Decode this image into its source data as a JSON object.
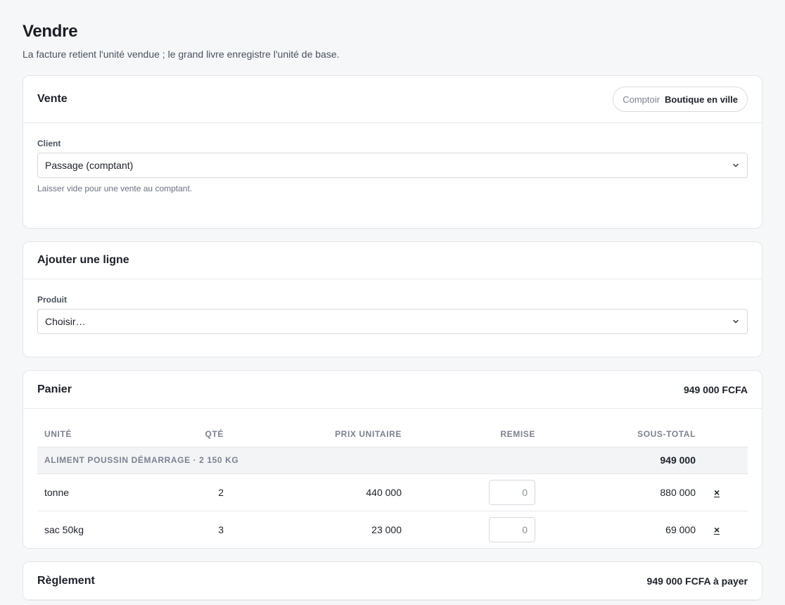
{
  "page": {
    "title": "Vendre",
    "subtitle": "La facture retient l'unité vendue ; le grand livre enregistre l'unité de base."
  },
  "sale": {
    "heading": "Vente",
    "counter_label": "Comptoir",
    "counter_value": "Boutique en ville",
    "client_label": "Client",
    "client_value": "Passage (comptant)",
    "client_hint": "Laisser vide pour une vente au comptant."
  },
  "add_line": {
    "heading": "Ajouter une ligne",
    "product_label": "Produit",
    "product_value": "Choisir…"
  },
  "cart": {
    "heading": "Panier",
    "total": "949 000 FCFA",
    "columns": {
      "unit": "Unité",
      "qty": "Qté",
      "unit_price": "Prix unitaire",
      "discount": "Remise",
      "subtotal": "Sous-total"
    },
    "group": {
      "label": "Aliment poussin démarrage · 2 150 kg",
      "total": "949 000"
    },
    "lines": [
      {
        "unit": "tonne",
        "qty": "2",
        "price": "440 000",
        "discount": "0",
        "subtotal": "880 000",
        "remove": "×"
      },
      {
        "unit": "sac 50kg",
        "qty": "3",
        "price": "23 000",
        "discount": "0",
        "subtotal": "69 000",
        "remove": "×"
      }
    ]
  },
  "payment": {
    "heading": "Règlement",
    "due": "949 000 FCFA à payer"
  },
  "icons": {
    "select_chevron": "chevron-down-icon"
  }
}
